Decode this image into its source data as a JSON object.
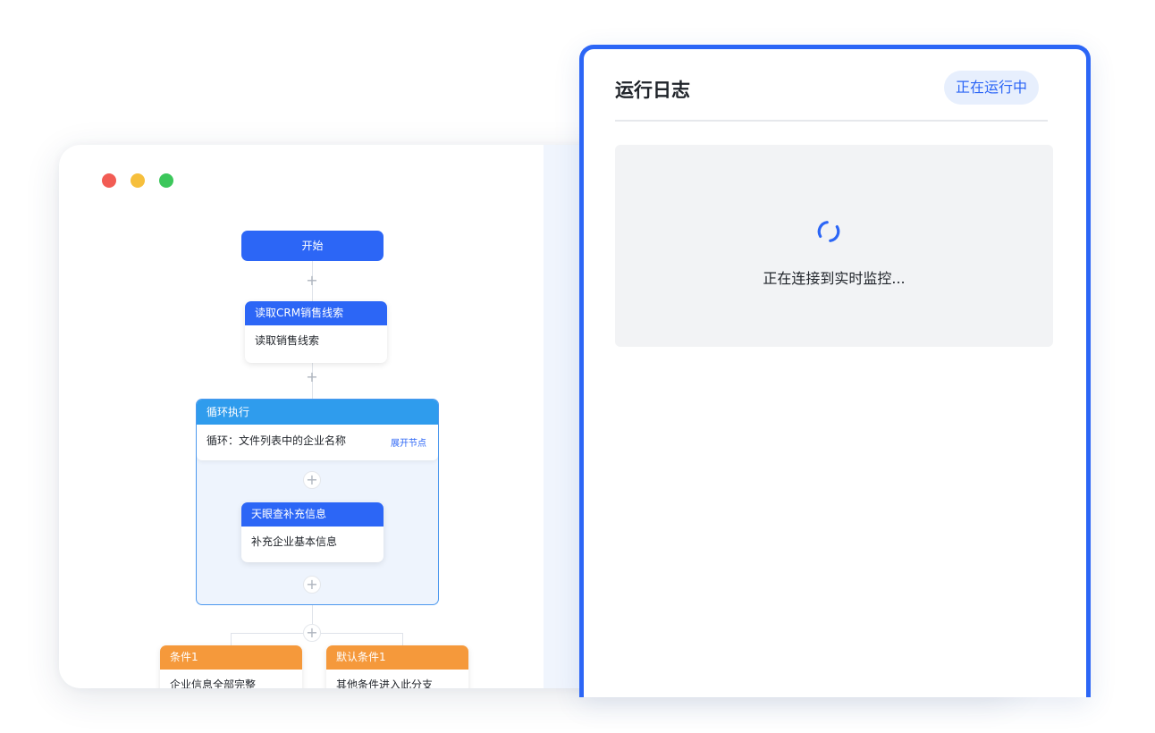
{
  "workflow": {
    "start_label": "开始",
    "crm_node": {
      "title": "读取CRM销售线索",
      "desc": "读取销售线索"
    },
    "loop_node": {
      "title": "循环执行",
      "desc": "循环：文件列表中的企业名称",
      "expand_label": "展开节点"
    },
    "enrich_node": {
      "title": "天眼查补充信息",
      "desc": "补充企业基本信息"
    },
    "branches": [
      {
        "title": "条件1",
        "desc": "企业信息全部完整"
      },
      {
        "title": "默认条件1",
        "desc": "其他条件进入此分支"
      }
    ],
    "plus_symbol": "+"
  },
  "log_panel": {
    "title": "运行日志",
    "status": "正在运行中",
    "message": "正在连接到实时监控..."
  },
  "colors": {
    "primary": "#2c66f6",
    "loop_header": "#2f9ced",
    "branch_header": "#f5993b",
    "status_pill_bg": "#e7effd"
  },
  "icons": [
    "traffic-light-close",
    "traffic-light-minimize",
    "traffic-light-zoom",
    "plus-icon",
    "loading-spinner-icon"
  ]
}
